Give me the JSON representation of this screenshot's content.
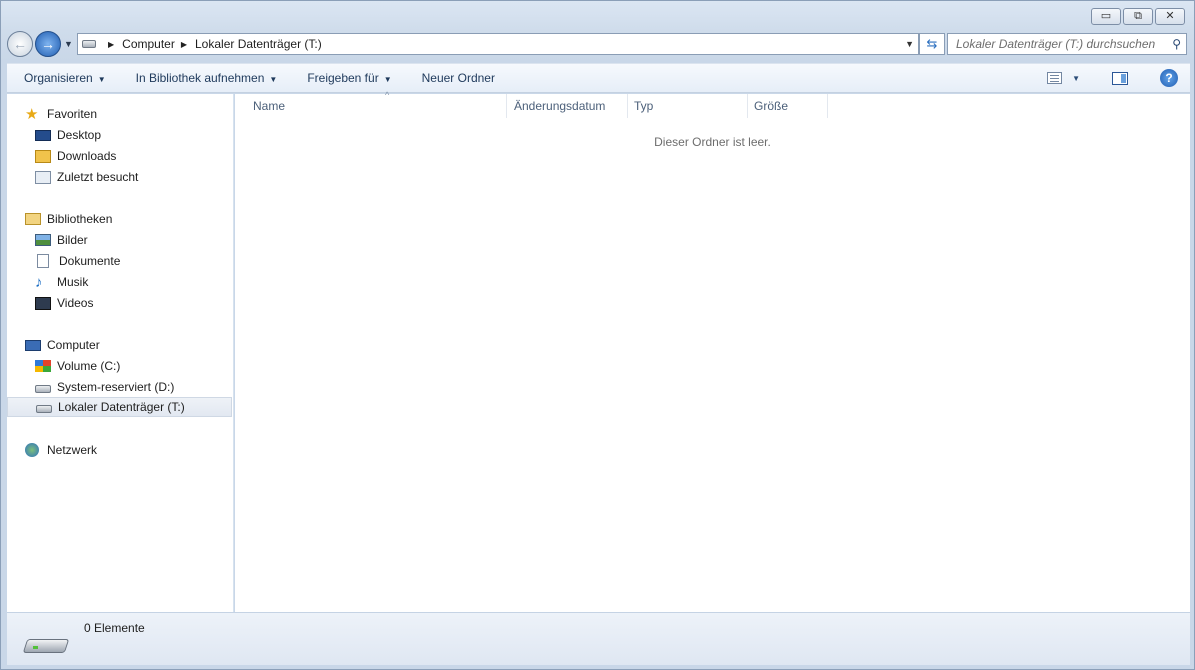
{
  "window": {
    "caption_buttons": {
      "minimize": "▭",
      "maximize": "⧉",
      "close": "✕"
    }
  },
  "address_bar": {
    "breadcrumbs": [
      "Computer",
      "Lokaler Datenträger (T:)"
    ]
  },
  "search": {
    "placeholder": "Lokaler Datenträger (T:) durchsuchen"
  },
  "toolbar": {
    "organize": "Organisieren",
    "add_to_library": "In Bibliothek aufnehmen",
    "share_with": "Freigeben für",
    "new_folder": "Neuer Ordner"
  },
  "navigation": {
    "favorites": {
      "label": "Favoriten",
      "items": [
        "Desktop",
        "Downloads",
        "Zuletzt besucht"
      ]
    },
    "libraries": {
      "label": "Bibliotheken",
      "items": [
        "Bilder",
        "Dokumente",
        "Musik",
        "Videos"
      ]
    },
    "computer": {
      "label": "Computer",
      "items": [
        "Volume (C:)",
        "System-reserviert (D:)",
        "Lokaler Datenträger (T:)"
      ],
      "selected": "Lokaler Datenträger (T:)"
    },
    "network": {
      "label": "Netzwerk"
    }
  },
  "columns": [
    "Name",
    "Änderungsdatum",
    "Typ",
    "Größe"
  ],
  "content": {
    "empty_message": "Dieser Ordner ist leer."
  },
  "status_bar": {
    "item_count": "0 Elemente"
  },
  "icons": {
    "back": "back-arrow-icon",
    "forward": "forward-arrow-icon",
    "refresh": "refresh-icon",
    "search": "magnifier-icon",
    "help": "help-icon"
  },
  "colors": {
    "accent": "#1f5cb0",
    "toolbar_text": "#1e395b",
    "empty_text": "#6d6d6d"
  }
}
